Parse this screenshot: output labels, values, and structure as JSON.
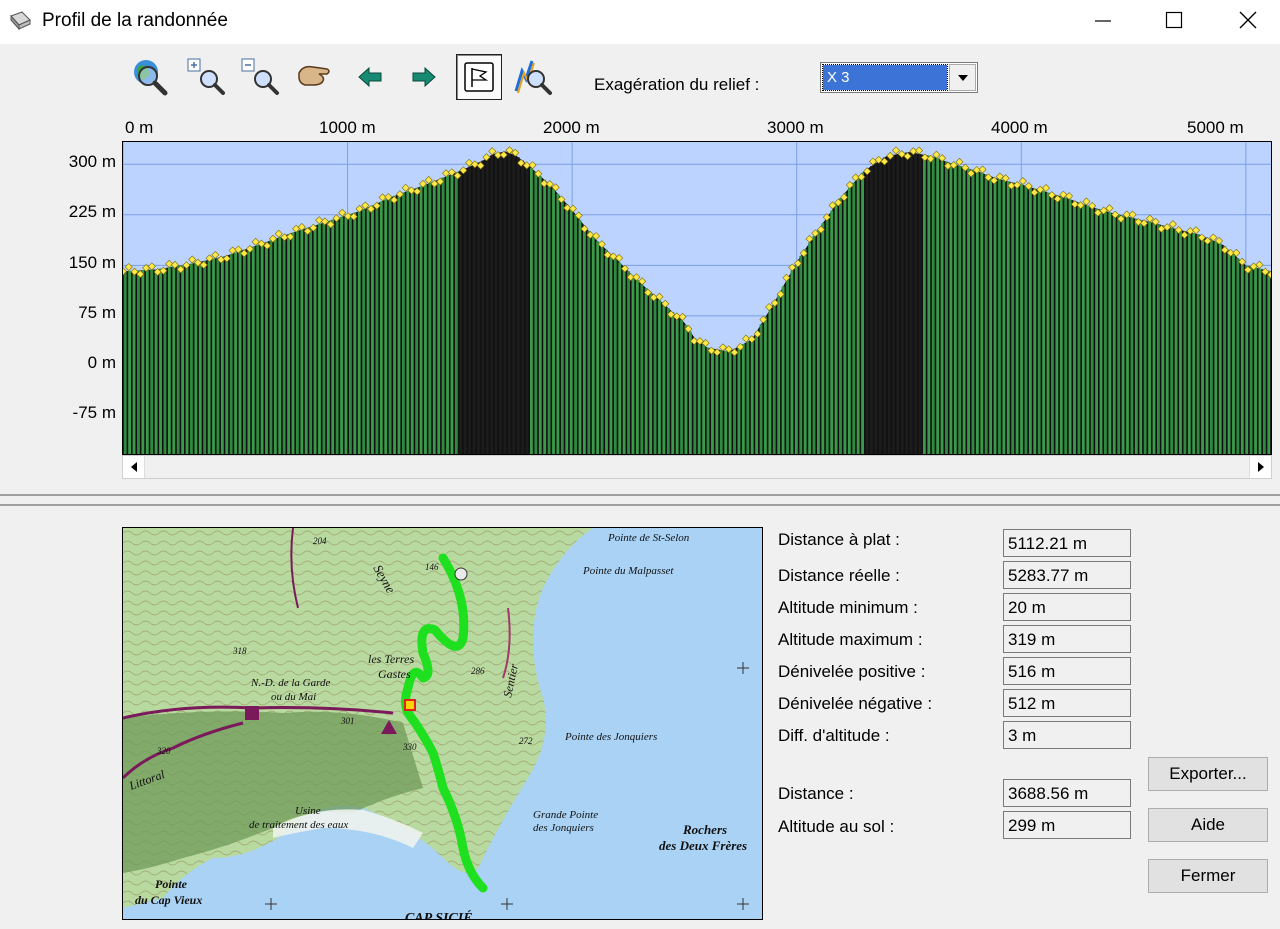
{
  "window": {
    "title": "Profil de la randonnée"
  },
  "toolbar": {
    "buttons": [
      {
        "name": "zoom-globe-button",
        "icon": "globe-magnifier-icon"
      },
      {
        "name": "zoom-in-button",
        "icon": "zoom-in-icon"
      },
      {
        "name": "zoom-out-button",
        "icon": "zoom-out-icon"
      },
      {
        "name": "pan-hand-button",
        "icon": "hand-icon"
      },
      {
        "name": "previous-button",
        "icon": "arrow-left-icon"
      },
      {
        "name": "next-button",
        "icon": "arrow-right-icon"
      },
      {
        "name": "flag-mode-button",
        "icon": "flag-icon",
        "active": true
      },
      {
        "name": "profile-search-button",
        "icon": "profile-magnifier-icon"
      }
    ],
    "relief_label": "Exagération du relief :",
    "relief_value": "X 3"
  },
  "chart_data": {
    "type": "area",
    "title": "",
    "xlabel": "",
    "ylabel": "",
    "x_ticks": [
      "0 m",
      "1000 m",
      "2000 m",
      "3000 m",
      "4000 m",
      "5000 m"
    ],
    "y_ticks": [
      "300 m",
      "225 m",
      "150 m",
      "75 m",
      "0 m",
      "-75 m"
    ],
    "xlim": [
      0,
      5112
    ],
    "ylim": [
      -130,
      333
    ],
    "series": [
      {
        "x": [
          0,
          150,
          300,
          450,
          600,
          750,
          900,
          1050,
          1200,
          1350,
          1500,
          1600,
          1650,
          1700,
          1750,
          1800,
          1900,
          2000,
          2100,
          2200,
          2300,
          2400,
          2500,
          2550,
          2600,
          2700,
          2800,
          2900,
          3000,
          3100,
          3200,
          3300,
          3400,
          3500,
          3600,
          3700,
          3800,
          3900,
          4000,
          4100,
          4200,
          4300,
          4400,
          4500,
          4600,
          4700,
          4800,
          4900,
          5000,
          5112
        ],
        "y": [
          141,
          144,
          152,
          163,
          180,
          198,
          214,
          230,
          252,
          270,
          290,
          305,
          315,
          319,
          313,
          300,
          270,
          232,
          190,
          158,
          125,
          95,
          65,
          40,
          28,
          22,
          40,
          95,
          155,
          205,
          252,
          290,
          312,
          318,
          312,
          300,
          290,
          278,
          270,
          260,
          250,
          238,
          228,
          220,
          212,
          203,
          195,
          180,
          150,
          141
        ]
      }
    ],
    "grid": true,
    "legend": "none"
  },
  "stats": [
    {
      "label": "Distance à plat :",
      "value": "5112.21 m"
    },
    {
      "label": "Distance réelle :",
      "value": "5283.77 m"
    },
    {
      "label": "Altitude minimum :",
      "value": "20 m"
    },
    {
      "label": "Altitude maximum :",
      "value": "319 m"
    },
    {
      "label": "Dénivelée positive :",
      "value": "516 m"
    },
    {
      "label": "Dénivelée négative :",
      "value": "512 m"
    },
    {
      "label": "Diff. d'altitude :",
      "value": "3 m"
    }
  ],
  "cursor": [
    {
      "label": "Distance :",
      "value": "3688.56 m"
    },
    {
      "label": "Altitude au sol :",
      "value": "299 m"
    }
  ],
  "buttons": {
    "export": "Exporter...",
    "help": "Aide",
    "close": "Fermer"
  },
  "map": {
    "labels": {
      "st_selon": "Pointe de St-Selon",
      "malpasset": "Pointe du Malpasset",
      "terres": "les Terres",
      "gastes": "Gastes",
      "garde1": "N.-D. de la Garde",
      "garde2": "ou du Mai",
      "jonquiers": "Pointe des Jonquiers",
      "grande1": "Grande Pointe",
      "grande2": "des Jonquiers",
      "rochers1": "Rochers",
      "rochers2": "des Deux Frères",
      "usine1": "Usine",
      "usine2": "de traitement des eaux",
      "capvieux1": "Pointe",
      "capvieux2": "du Cap Vieux",
      "sentier": "Sentier",
      "littoral": "Littoral",
      "seyne": "Seyne",
      "cap": "CAP SICIÉ",
      "h204": "204",
      "h146": "146",
      "h318": "318",
      "h301": "301",
      "h330": "330",
      "h286": "286",
      "h272": "272",
      "h320": "320"
    },
    "colors": {
      "track": "#1fe01f",
      "sea": "#a9d2f5",
      "land": "#b8d9a0",
      "forest": "#6f9a5a"
    }
  }
}
